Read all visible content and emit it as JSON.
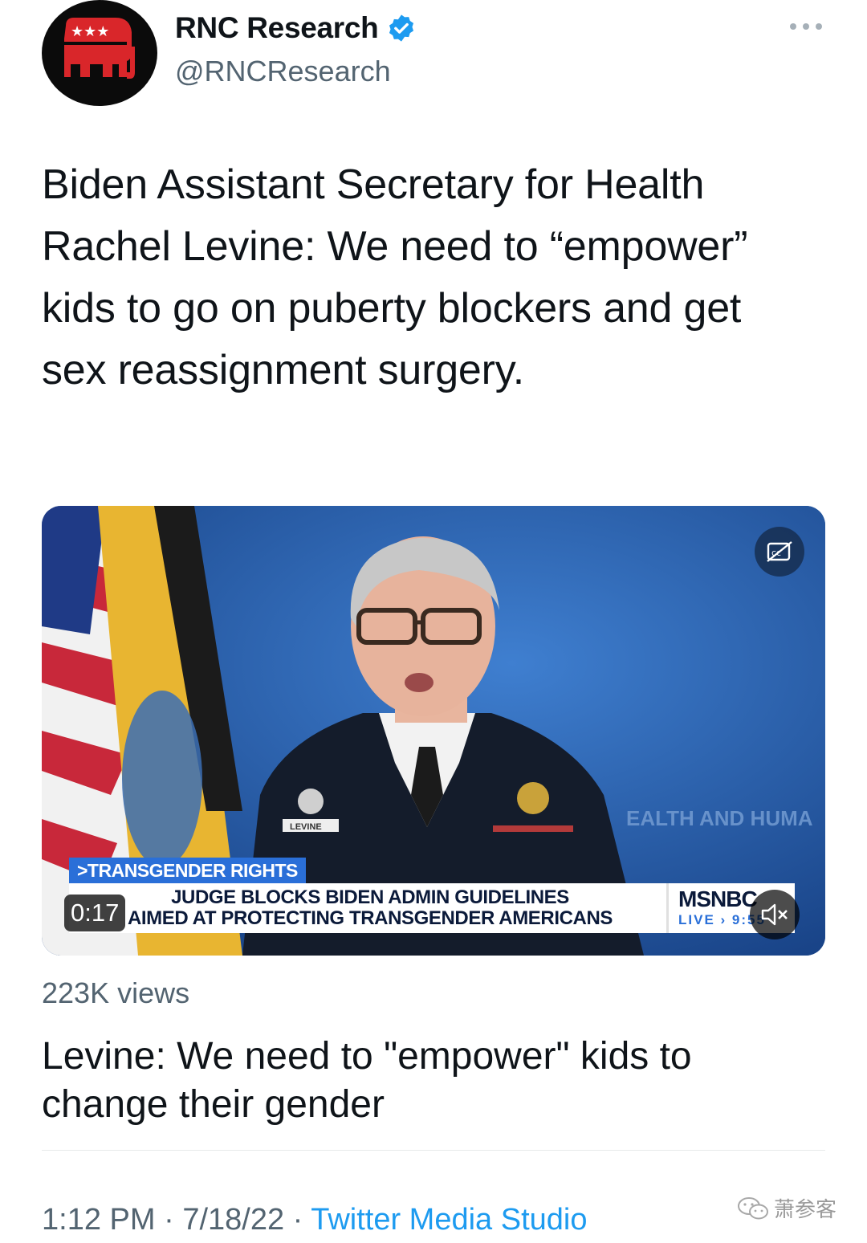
{
  "author": {
    "display_name": "RNC Research",
    "handle": "@RNCResearch",
    "verified": true,
    "avatar_icon": "gop-elephant-icon"
  },
  "tweet": {
    "text": "Biden Assistant Secretary for Health Rachel Levine: We need to “empower” kids to go on puberty blockers and get sex reassignment surgery."
  },
  "video": {
    "timestamp": "0:17",
    "tag": ">TRANSGENDER RIGHTS",
    "headline_line1": "JUDGE BLOCKS BIDEN ADMIN GUIDELINES",
    "headline_line2": "AIMED AT PROTECTING TRANSGENDER AMERICANS",
    "network": "MSNBC",
    "live_label": "LIVE › 9:55",
    "backdrop_text": "EALTH AND HUMA",
    "nameplate": "LEVINE",
    "captions_icon": "closed-captions-icon",
    "mute_icon": "speaker-muted-icon"
  },
  "stats": {
    "views": "223K views"
  },
  "card": {
    "title": "Levine: We need to \"empower\" kids to change their gender"
  },
  "meta": {
    "time": "1:12 PM",
    "date": "7/18/22",
    "separator": "·",
    "source": "Twitter Media Studio"
  },
  "watermark": {
    "text": "萧参客"
  },
  "colors": {
    "accent": "#1d9bf0",
    "secondary_text": "#536471",
    "msnbc_blue": "#2a6fd8"
  }
}
